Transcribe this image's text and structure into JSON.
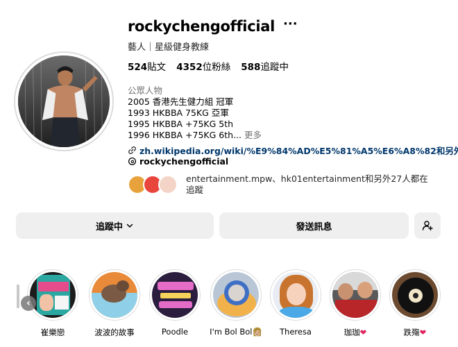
{
  "profile": {
    "username": "rockychengofficial",
    "more_glyph": "···",
    "category_line": "藝人｜星級健身教練",
    "stats": {
      "posts": "524",
      "posts_label": "貼文",
      "followers": "4352",
      "followers_label": "位粉絲",
      "following": "588",
      "following_label": "追蹤中"
    },
    "bio_category": "公眾人物",
    "bio_lines": [
      "2005 香港先生健力組 冠軍",
      "1993 HKBBA 75KG 亞軍",
      "1995 HKBBA +75KG 5th",
      "1996 HKBBA +75KG 6th..."
    ],
    "bio_more": "更多",
    "link": "zh.wikipedia.org/wiki/%E9%84%AD%E5%81%A5%E6%A8%82和另外...",
    "threads_handle": "rockychengofficial",
    "followed_by": "entertainment.mpw、hk01entertainment和另外27人都在追蹤"
  },
  "buttons": {
    "follow": "追蹤中",
    "message": "發送訊息"
  },
  "highlights": [
    {
      "label": "崔樂戀",
      "heart": ""
    },
    {
      "label": "波波的故事",
      "heart": ""
    },
    {
      "label": "Poodle",
      "heart": ""
    },
    {
      "label": "I'm Bol Bol👩🏼",
      "heart": ""
    },
    {
      "label": "Theresa",
      "heart": ""
    },
    {
      "label": "珈珈",
      "heart": "❤"
    },
    {
      "label": "跌殤",
      "heart": "❤"
    }
  ],
  "icons": {
    "more": "more-options-icon",
    "link": "link-icon",
    "threads": "threads-icon",
    "chevron": "chevron-down-icon",
    "add_user": "add-user-icon",
    "scroll_left": "chevron-left-icon"
  },
  "colors": {
    "link": "#00376b",
    "button_bg": "#efefef",
    "muted": "#737373",
    "heart": "#e0245e"
  }
}
